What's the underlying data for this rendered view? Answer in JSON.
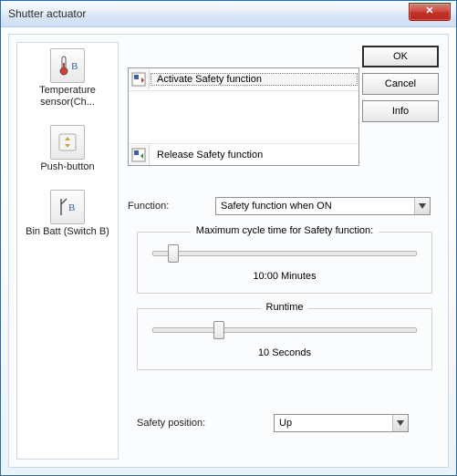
{
  "window": {
    "title": "Shutter actuator",
    "close_glyph": "✕"
  },
  "buttons": {
    "ok": "OK",
    "cancel": "Cancel",
    "info": "Info"
  },
  "sidebar": {
    "items": [
      {
        "label": "Temperature sensor(Ch...",
        "icon": "thermometer-b-icon"
      },
      {
        "label": "Push-button",
        "icon": "push-button-icon"
      },
      {
        "label": "Bin Batt (Switch B)",
        "icon": "switch-b-icon"
      }
    ]
  },
  "actions": {
    "items": [
      {
        "label": "Activate Safety function",
        "icon": "activate-safety-icon",
        "selected": true
      },
      {
        "label": "Release Safety function",
        "icon": "release-safety-icon",
        "selected": false
      }
    ]
  },
  "function": {
    "label": "Function:",
    "value": "Safety function when ON"
  },
  "max_cycle": {
    "title": "Maximum cycle time for Safety function:",
    "value_text": "10:00 Minutes",
    "value_numeric": 10,
    "unit": "Minutes",
    "range": [
      0,
      120
    ],
    "thumb_percent": 8
  },
  "runtime": {
    "title": "Runtime",
    "value_text": "10 Seconds",
    "value_numeric": 10,
    "unit": "Seconds",
    "range": [
      0,
      120
    ],
    "thumb_percent": 25
  },
  "safety_position": {
    "label": "Safety position:",
    "value": "Up"
  },
  "colors": {
    "accent_blue": "#5a9bd5",
    "close_red": "#c13127"
  }
}
